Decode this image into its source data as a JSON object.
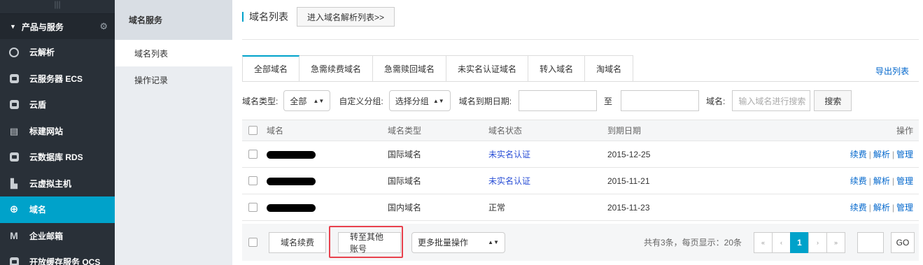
{
  "sidebar": {
    "grip": "|||",
    "group_label": "产品与服务",
    "items": [
      {
        "label": "云解析",
        "icon": "dns-icon",
        "active": false
      },
      {
        "label": "云服务器 ECS",
        "icon": "server-icon",
        "active": false
      },
      {
        "label": "云盾",
        "icon": "shield-icon",
        "active": false
      },
      {
        "label": "标建网站",
        "icon": "website-icon",
        "active": false
      },
      {
        "label": "云数据库 RDS",
        "icon": "database-icon",
        "active": false
      },
      {
        "label": "云虚拟主机",
        "icon": "virtual-host-icon",
        "active": false
      },
      {
        "label": "域名",
        "icon": "globe-icon",
        "active": true
      },
      {
        "label": "企业邮箱",
        "icon": "mail-icon",
        "active": false
      },
      {
        "label": "开放缓存服务 OCS",
        "icon": "cache-icon",
        "active": false
      }
    ]
  },
  "subnav": {
    "title": "域名服务",
    "links": [
      {
        "label": "域名列表",
        "active": true
      },
      {
        "label": "操作记录",
        "active": false
      }
    ]
  },
  "header": {
    "title": "域名列表",
    "dns_button": "进入域名解析列表>>"
  },
  "tabs": [
    "全部域名",
    "急需续费域名",
    "急需赎回域名",
    "未实名认证域名",
    "转入域名",
    "淘域名"
  ],
  "export_label": "导出列表",
  "filters": {
    "type_label": "域名类型:",
    "type_value": "全部",
    "group_label": "自定义分组:",
    "group_value": "选择分组",
    "expiry_label": "域名到期日期:",
    "to_label": "至",
    "domain_label": "域名:",
    "domain_placeholder": "输入域名进行搜索",
    "search_button": "搜索"
  },
  "table": {
    "columns": [
      "域名",
      "域名类型",
      "域名状态",
      "到期日期",
      "操作"
    ],
    "rows": [
      {
        "type": "国际域名",
        "status": "未实名认证",
        "date": "2015-12-25"
      },
      {
        "type": "国际域名",
        "status": "未实名认证",
        "date": "2015-11-21"
      },
      {
        "type": "国内域名",
        "status": "正常",
        "date": "2015-11-23"
      }
    ],
    "ops": [
      "续费",
      "解析",
      "管理"
    ]
  },
  "footer": {
    "renew_button": "域名续费",
    "transfer_button": "转至其他账号",
    "batch_select": "更多批量操作",
    "summary": "共有3条，每页显示：20条",
    "pages": [
      "«",
      "‹",
      "1",
      "›",
      "»"
    ],
    "go_button": "GO"
  },
  "colors": {
    "accent": "#00a2ca",
    "sidebar_bg": "#293038",
    "link": "#0066cc",
    "highlight_border": "#e8414d"
  }
}
